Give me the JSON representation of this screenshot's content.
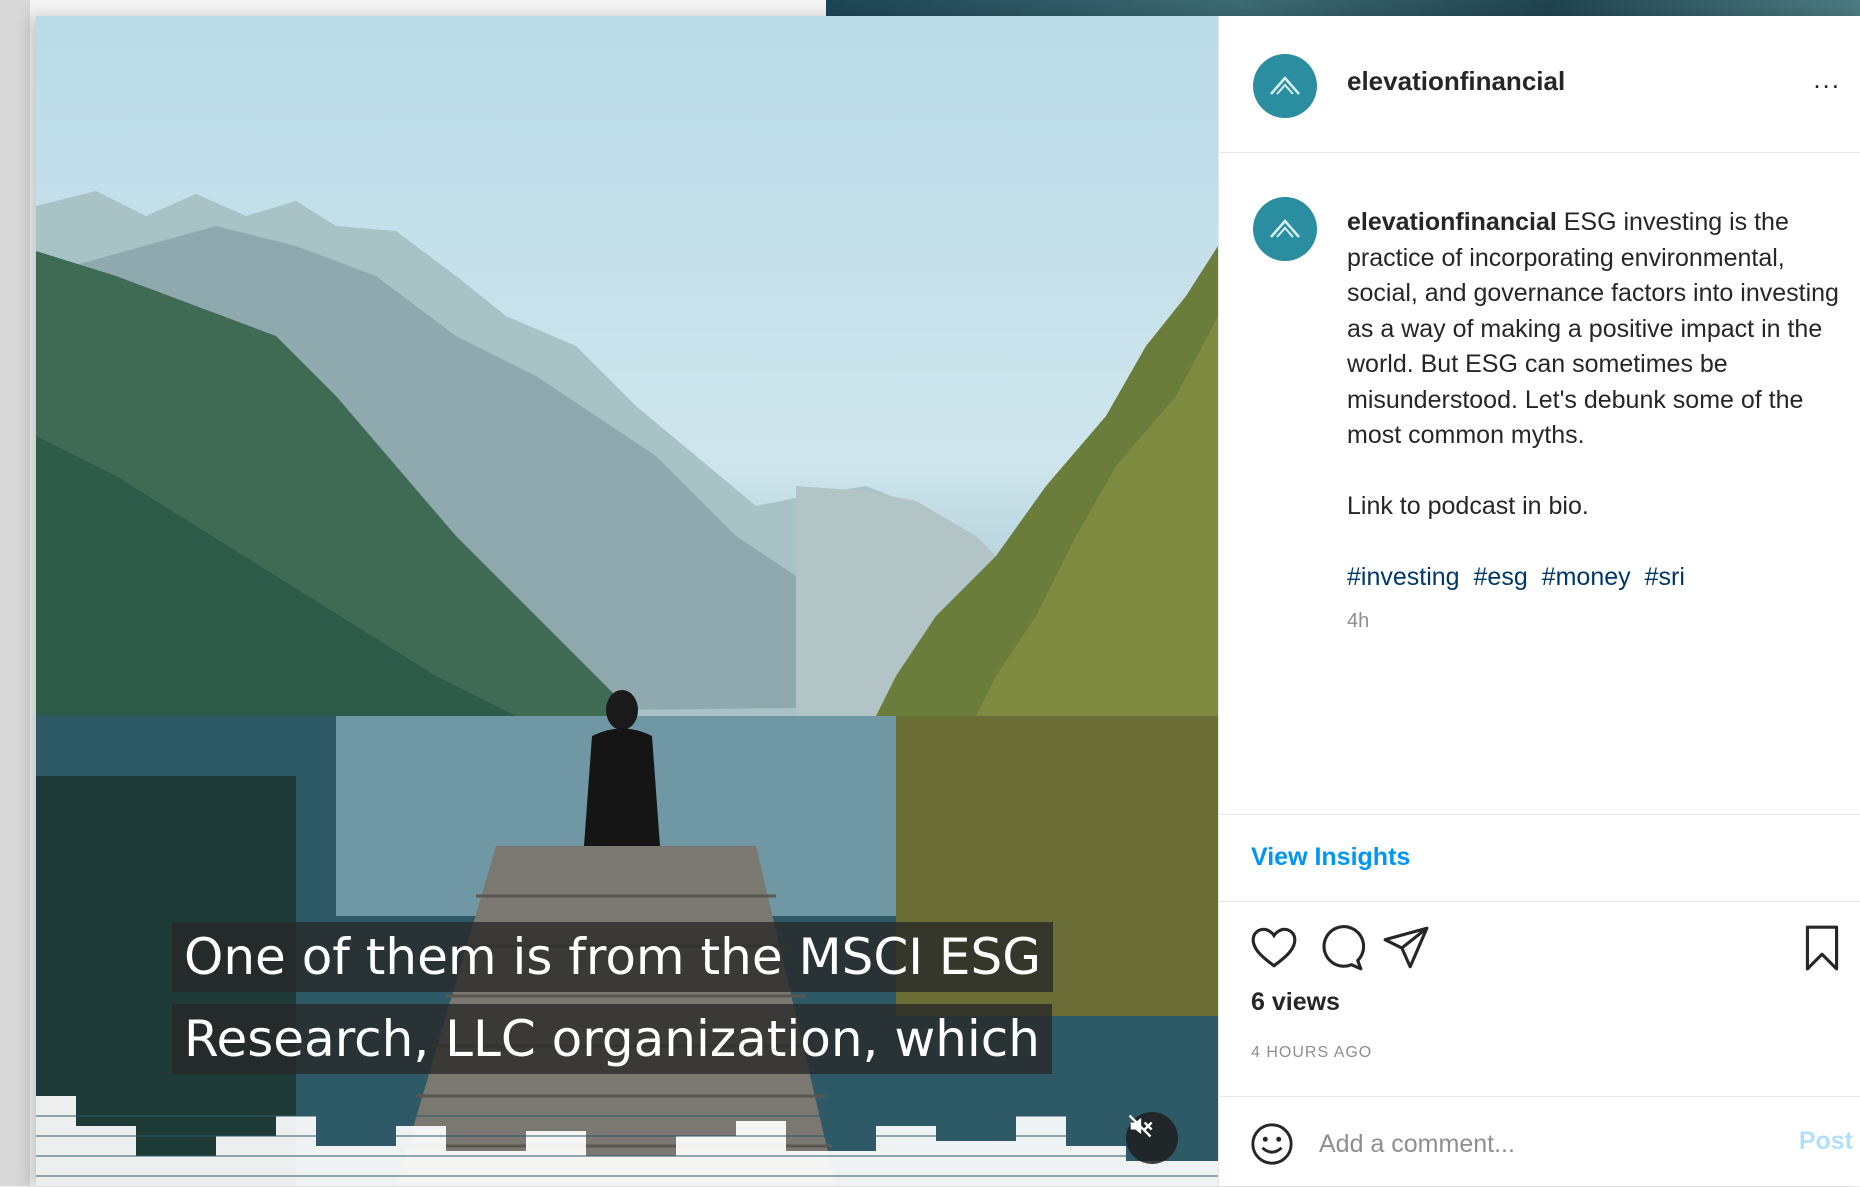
{
  "post": {
    "username": "elevationfinancial",
    "more_label": "...",
    "caption": {
      "author": "elevationfinancial",
      "text": "ESG investing is the practice of incorporating environmental, social, and governance factors into investing as a way of making a positive impact in the world. But ESG can sometimes be misunderstood. Let's debunk some of the most common myths.",
      "link_text": "Link to podcast in bio.",
      "hashtags": [
        "#investing",
        "#esg",
        "#money",
        "#sri"
      ],
      "time_ago": "4h"
    },
    "view_insights": "View Insights",
    "views": "6 views",
    "timestamp": "4 HOURS AGO",
    "comment": {
      "placeholder": "Add a comment...",
      "post_label": "Post"
    }
  },
  "video": {
    "caption_lines": [
      "One of them is from the MSCI ESG",
      "Research, LLC organization, which"
    ],
    "muted": true
  },
  "colors": {
    "brand_avatar": "#2b8ea0",
    "link": "#0095f6",
    "hashtag": "#00376b",
    "post_disabled": "#b2dffc"
  },
  "icons": [
    "mountain-logo-icon",
    "heart-icon",
    "comment-icon",
    "share-icon",
    "bookmark-icon",
    "emoji-icon",
    "mute-icon"
  ]
}
